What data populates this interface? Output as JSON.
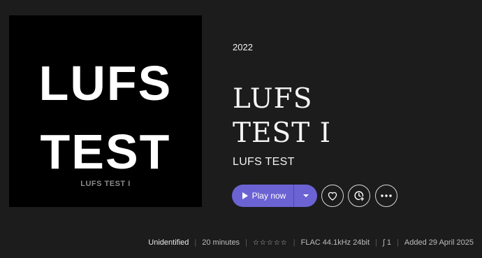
{
  "cover": {
    "line1": "LUFS",
    "line2": "TEST",
    "caption": "LUFS TEST I"
  },
  "album": {
    "year": "2022",
    "title_line1": "LUFS",
    "title_line2": "TEST I",
    "artist": "LUFS TEST"
  },
  "actions": {
    "play_label": "Play now"
  },
  "meta": {
    "status": "Unidentified",
    "duration": "20 minutes",
    "rating": "☆☆☆☆☆",
    "format": "FLAC 44.1kHz 24bit",
    "loudness_glyph": "∫",
    "loudness": "1",
    "added": "Added 29 April 2025"
  },
  "colors": {
    "background": "#1c1c1c",
    "accent": "#6b63d3"
  }
}
